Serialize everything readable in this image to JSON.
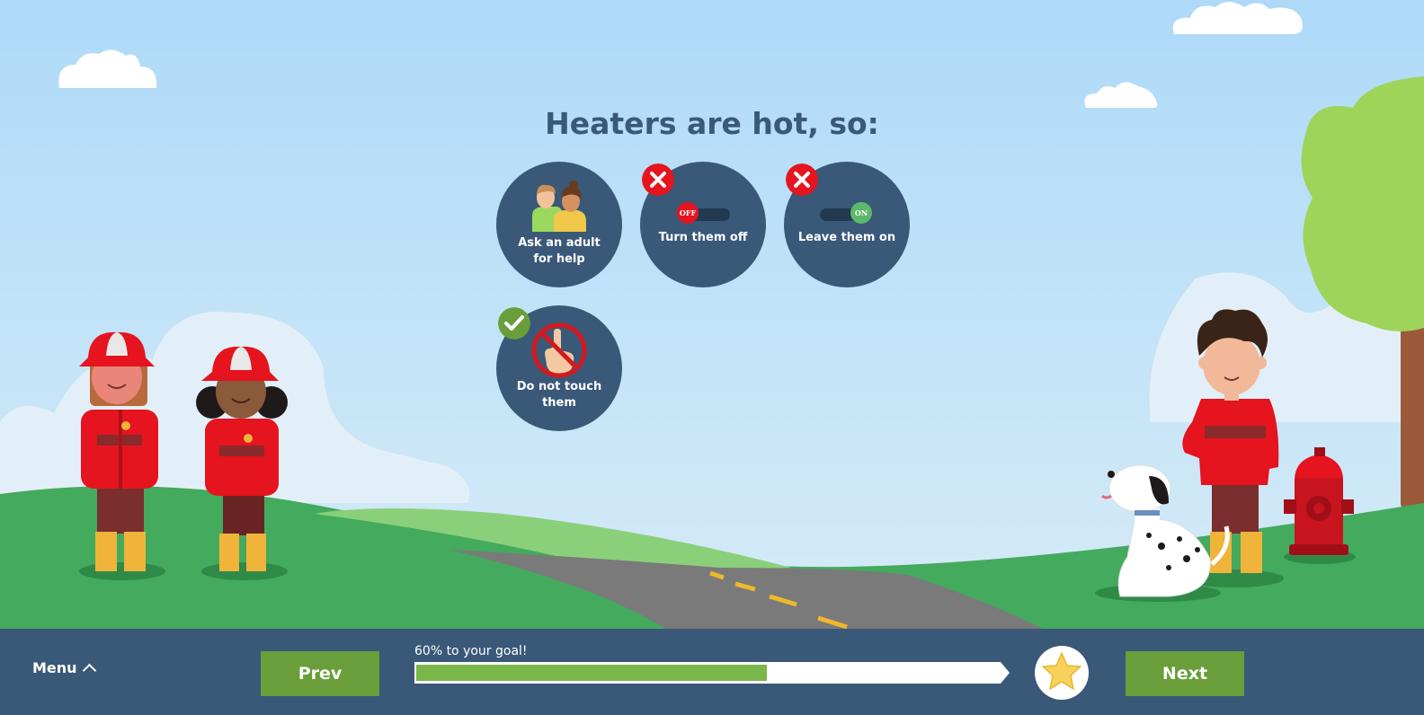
{
  "title": "Heaters are hot, so:",
  "options": [
    {
      "label": "Ask an adult for help",
      "status": "none",
      "icon": "adults-icon"
    },
    {
      "label": "Turn them off",
      "status": "wrong",
      "icon": "toggle-off-icon",
      "toggle_text": "OFF"
    },
    {
      "label": "Leave them on",
      "status": "wrong",
      "icon": "toggle-on-icon",
      "toggle_text": "ON"
    },
    {
      "label": "Do not touch them",
      "status": "correct",
      "icon": "no-touch-icon"
    }
  ],
  "footer": {
    "menu_label": "Menu",
    "prev_label": "Prev",
    "next_label": "Next",
    "progress_text": "60% to your goal!",
    "progress_value": 0.6,
    "goal_icon": "star-icon"
  },
  "colors": {
    "panel": "#3a5878",
    "button": "#6a9e3a",
    "progress_fill": "#7ab648",
    "wrong": "#e5141f",
    "correct": "#6a9e3a",
    "sky": "#b8dcf6",
    "grass": "#44aa5e"
  }
}
